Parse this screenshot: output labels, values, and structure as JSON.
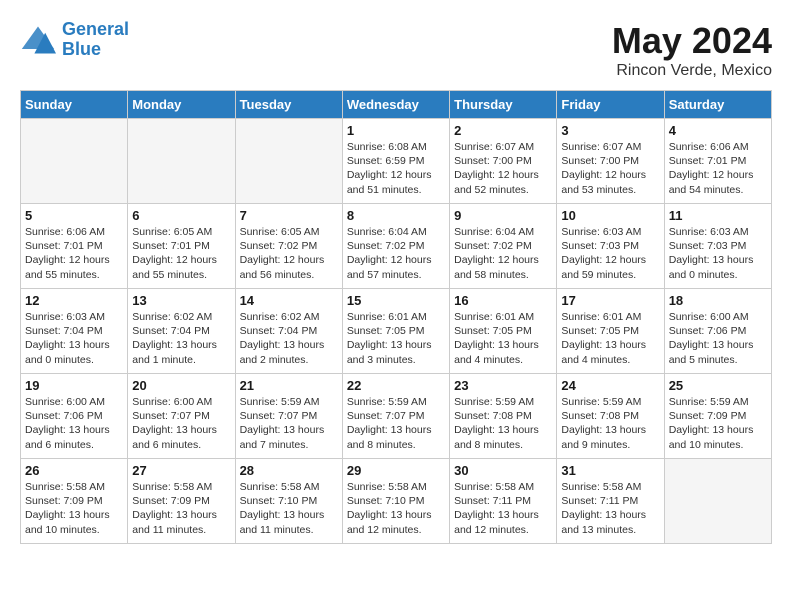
{
  "header": {
    "logo_line1": "General",
    "logo_line2": "Blue",
    "month": "May 2024",
    "location": "Rincon Verde, Mexico"
  },
  "weekdays": [
    "Sunday",
    "Monday",
    "Tuesday",
    "Wednesday",
    "Thursday",
    "Friday",
    "Saturday"
  ],
  "weeks": [
    [
      {
        "day": "",
        "info": ""
      },
      {
        "day": "",
        "info": ""
      },
      {
        "day": "",
        "info": ""
      },
      {
        "day": "1",
        "info": "Sunrise: 6:08 AM\nSunset: 6:59 PM\nDaylight: 12 hours and 51 minutes."
      },
      {
        "day": "2",
        "info": "Sunrise: 6:07 AM\nSunset: 7:00 PM\nDaylight: 12 hours and 52 minutes."
      },
      {
        "day": "3",
        "info": "Sunrise: 6:07 AM\nSunset: 7:00 PM\nDaylight: 12 hours and 53 minutes."
      },
      {
        "day": "4",
        "info": "Sunrise: 6:06 AM\nSunset: 7:01 PM\nDaylight: 12 hours and 54 minutes."
      }
    ],
    [
      {
        "day": "5",
        "info": "Sunrise: 6:06 AM\nSunset: 7:01 PM\nDaylight: 12 hours and 55 minutes."
      },
      {
        "day": "6",
        "info": "Sunrise: 6:05 AM\nSunset: 7:01 PM\nDaylight: 12 hours and 55 minutes."
      },
      {
        "day": "7",
        "info": "Sunrise: 6:05 AM\nSunset: 7:02 PM\nDaylight: 12 hours and 56 minutes."
      },
      {
        "day": "8",
        "info": "Sunrise: 6:04 AM\nSunset: 7:02 PM\nDaylight: 12 hours and 57 minutes."
      },
      {
        "day": "9",
        "info": "Sunrise: 6:04 AM\nSunset: 7:02 PM\nDaylight: 12 hours and 58 minutes."
      },
      {
        "day": "10",
        "info": "Sunrise: 6:03 AM\nSunset: 7:03 PM\nDaylight: 12 hours and 59 minutes."
      },
      {
        "day": "11",
        "info": "Sunrise: 6:03 AM\nSunset: 7:03 PM\nDaylight: 13 hours and 0 minutes."
      }
    ],
    [
      {
        "day": "12",
        "info": "Sunrise: 6:03 AM\nSunset: 7:04 PM\nDaylight: 13 hours and 0 minutes."
      },
      {
        "day": "13",
        "info": "Sunrise: 6:02 AM\nSunset: 7:04 PM\nDaylight: 13 hours and 1 minute."
      },
      {
        "day": "14",
        "info": "Sunrise: 6:02 AM\nSunset: 7:04 PM\nDaylight: 13 hours and 2 minutes."
      },
      {
        "day": "15",
        "info": "Sunrise: 6:01 AM\nSunset: 7:05 PM\nDaylight: 13 hours and 3 minutes."
      },
      {
        "day": "16",
        "info": "Sunrise: 6:01 AM\nSunset: 7:05 PM\nDaylight: 13 hours and 4 minutes."
      },
      {
        "day": "17",
        "info": "Sunrise: 6:01 AM\nSunset: 7:05 PM\nDaylight: 13 hours and 4 minutes."
      },
      {
        "day": "18",
        "info": "Sunrise: 6:00 AM\nSunset: 7:06 PM\nDaylight: 13 hours and 5 minutes."
      }
    ],
    [
      {
        "day": "19",
        "info": "Sunrise: 6:00 AM\nSunset: 7:06 PM\nDaylight: 13 hours and 6 minutes."
      },
      {
        "day": "20",
        "info": "Sunrise: 6:00 AM\nSunset: 7:07 PM\nDaylight: 13 hours and 6 minutes."
      },
      {
        "day": "21",
        "info": "Sunrise: 5:59 AM\nSunset: 7:07 PM\nDaylight: 13 hours and 7 minutes."
      },
      {
        "day": "22",
        "info": "Sunrise: 5:59 AM\nSunset: 7:07 PM\nDaylight: 13 hours and 8 minutes."
      },
      {
        "day": "23",
        "info": "Sunrise: 5:59 AM\nSunset: 7:08 PM\nDaylight: 13 hours and 8 minutes."
      },
      {
        "day": "24",
        "info": "Sunrise: 5:59 AM\nSunset: 7:08 PM\nDaylight: 13 hours and 9 minutes."
      },
      {
        "day": "25",
        "info": "Sunrise: 5:59 AM\nSunset: 7:09 PM\nDaylight: 13 hours and 10 minutes."
      }
    ],
    [
      {
        "day": "26",
        "info": "Sunrise: 5:58 AM\nSunset: 7:09 PM\nDaylight: 13 hours and 10 minutes."
      },
      {
        "day": "27",
        "info": "Sunrise: 5:58 AM\nSunset: 7:09 PM\nDaylight: 13 hours and 11 minutes."
      },
      {
        "day": "28",
        "info": "Sunrise: 5:58 AM\nSunset: 7:10 PM\nDaylight: 13 hours and 11 minutes."
      },
      {
        "day": "29",
        "info": "Sunrise: 5:58 AM\nSunset: 7:10 PM\nDaylight: 13 hours and 12 minutes."
      },
      {
        "day": "30",
        "info": "Sunrise: 5:58 AM\nSunset: 7:11 PM\nDaylight: 13 hours and 12 minutes."
      },
      {
        "day": "31",
        "info": "Sunrise: 5:58 AM\nSunset: 7:11 PM\nDaylight: 13 hours and 13 minutes."
      },
      {
        "day": "",
        "info": ""
      }
    ]
  ]
}
